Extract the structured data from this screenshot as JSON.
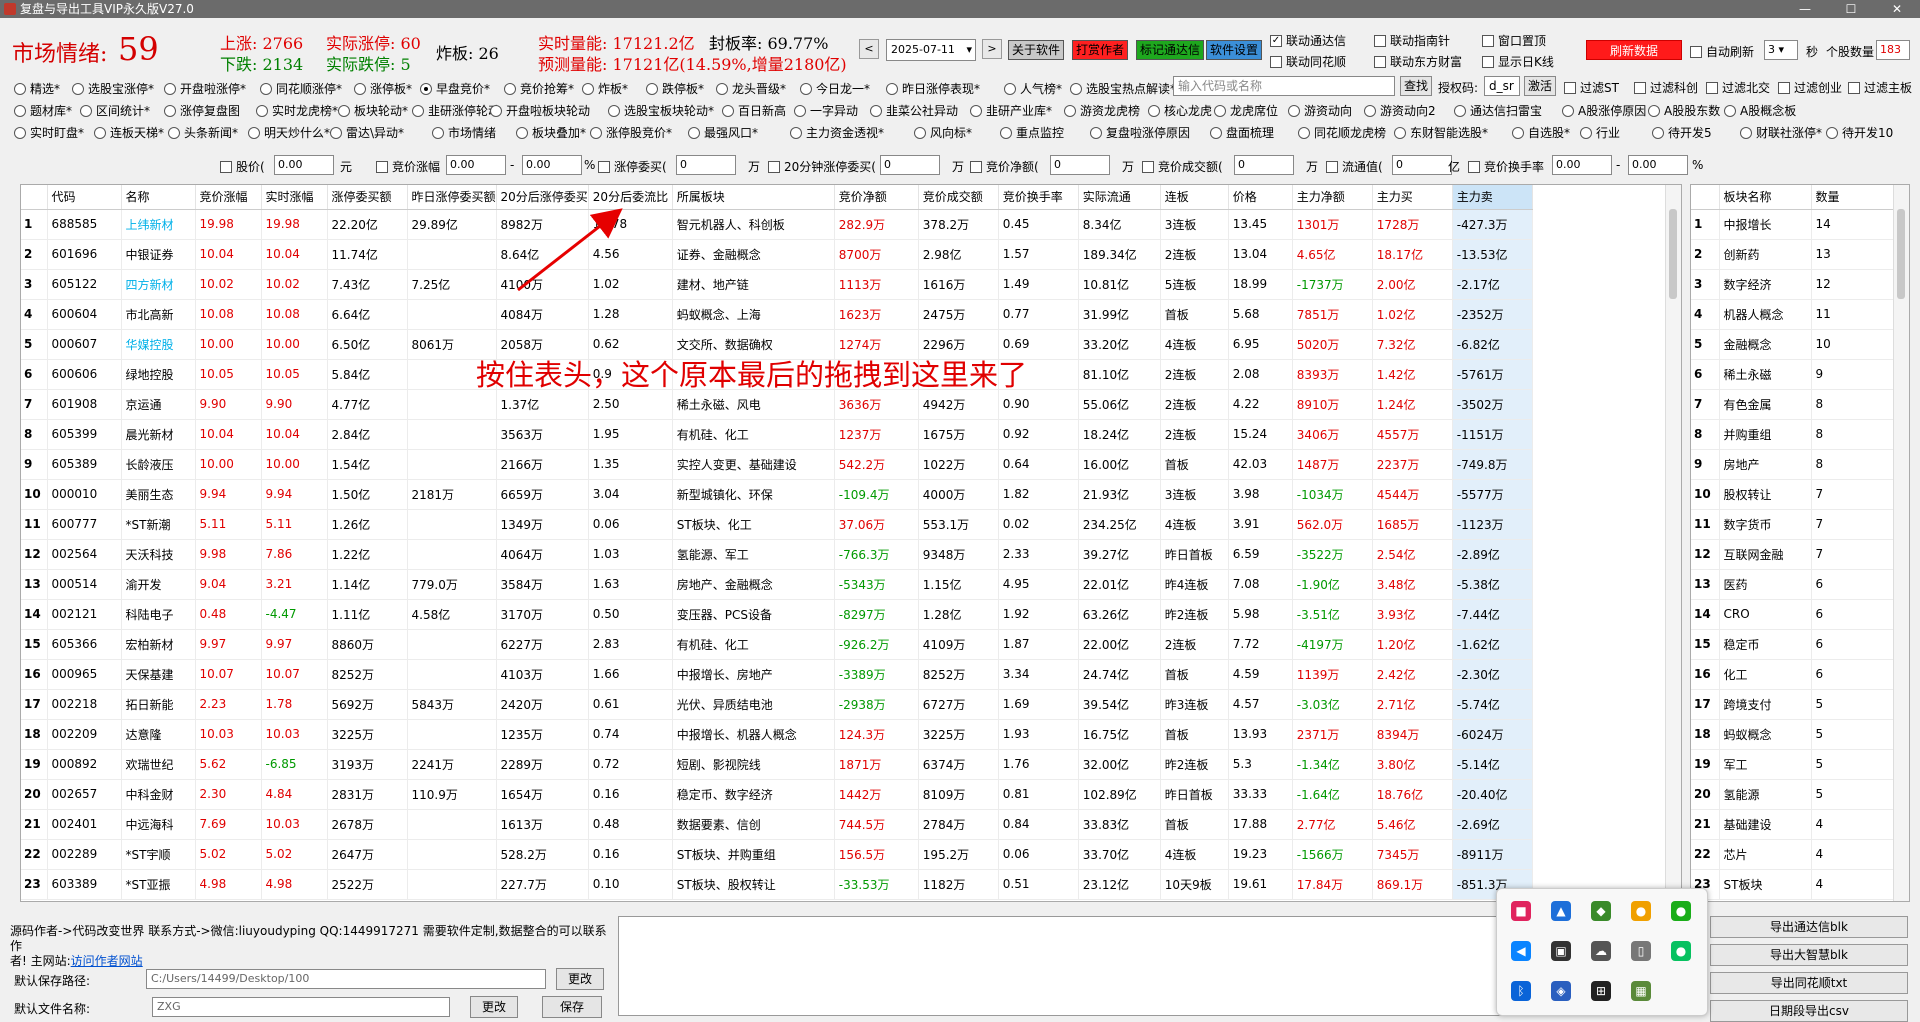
{
  "window": {
    "title": "复盘与导出工具VIP永久版V27.0"
  },
  "stats": {
    "sentiment_label": "市场情绪:",
    "sentiment_value": "59",
    "rise": "上涨: 2766",
    "real_limit_up": "实际涨停: 60",
    "fall": "下跌: 2134",
    "real_limit_down": "实际跌停: 5",
    "broken": "炸板: 26",
    "realtime_vol": "实时量能: 17121.2亿",
    "seal_rate": "封板率: 69.77%",
    "forecast_vol": "预测量能: 17121亿(14.59%,增量2180亿)"
  },
  "toolbar": {
    "date": "2025-07-11",
    "about": "关于软件",
    "reward": "打赏作者",
    "tdx": "标记通达信",
    "settings": "软件设置",
    "link_tdx": "联动通达信",
    "link_ths": "联动同花顺",
    "link_znz": "联动指南针",
    "link_dfcf": "联动东方财富",
    "win_top": "窗口置顶",
    "show_kline": "显示日K线",
    "refresh": "刷新数据",
    "auto_refresh": "自动刷新",
    "interval": "3",
    "sec": "秒",
    "stock_count_label": "个股数量",
    "stock_count": "183"
  },
  "tabs": {
    "row1": [
      "精选*",
      "选股宝涨停*",
      "开盘啦涨停*",
      "同花顺涨停*",
      "涨停板*",
      "早盘竞价*",
      "竞价抢筹*",
      "炸板*",
      "跌停板*",
      "龙头晋级*",
      "今日龙一*",
      "昨日涨停表现*",
      "人气榜*",
      "选股宝热点解读*"
    ],
    "row2": [
      "题材库*",
      "区间统计*",
      "涨停复盘图",
      "实时龙虎榜*",
      "板块轮动*",
      "韭研涨停轮动",
      "开盘啦板块轮动",
      "选股宝板块轮动*",
      "百日新高",
      "一字异动",
      "韭菜公社异动",
      "韭研产业库*",
      "游资龙虎榜",
      "核心龙虎",
      "龙虎席位",
      "游资动向",
      "游资动向2",
      "通达信扫雷宝",
      "A股涨停原因",
      "A股股东数",
      "A股概念板"
    ],
    "row3": [
      "实时盯盘*",
      "连板天梯*",
      "头条新闻*",
      "明天炒什么*",
      "雷达\\异动*",
      "市场情绪",
      "板块叠加*",
      "涨停股竞价*",
      "最强风口*",
      "主力资金透视*",
      "风向标*",
      "重点监控",
      "复盘啦涨停原因",
      "盘面梳理",
      "同花顺龙虎榜",
      "东财智能选股*",
      "自选股*",
      "行业",
      "待开发5",
      "财联社涨停*",
      "待开发10"
    ],
    "selected": "早盘竞价*",
    "search_placeholder": "输入代码或名称",
    "search_btn": "查找",
    "auth_label": "授权码:",
    "auth_value": "d_sr",
    "activate": "激活",
    "filters": [
      "过滤ST",
      "过滤科创",
      "过滤北交",
      "过滤创业",
      "过滤主板"
    ]
  },
  "filterbar": {
    "labels": [
      "股价(",
      "元",
      "竞价涨幅",
      "-",
      "%",
      "涨停委买(",
      "万",
      "20分钟涨停委买(",
      "万",
      "竞价净额(",
      "万",
      "竞价成交额(",
      "万",
      "流通值(",
      "亿",
      "竞价换手率",
      "-",
      "%"
    ],
    "zero": "0.00",
    "zero_int": "0"
  },
  "table": {
    "columns": [
      "",
      "代码",
      "名称",
      "竞价涨幅",
      "实时涨幅",
      "涨停委买额",
      "昨日涨停委买额",
      "20分后涨停委买",
      "20分后委流比",
      "所属板块",
      "竞价净额",
      "竞价成交额",
      "竞价换手率",
      "实际流通",
      "连板",
      "价格",
      "主力净额",
      "主力买",
      "主力卖"
    ],
    "rows": [
      [
        "1",
        "688585",
        "上纬新材",
        "19.98",
        "19.98",
        "22.20亿",
        "29.89亿",
        "8982万",
        "10.78",
        "智元机器人、科创板",
        "282.9万",
        "378.2万",
        "0.45",
        "8.34亿",
        "3连板",
        "13.45",
        "1301万",
        "1728万",
        "-427.3万"
      ],
      [
        "2",
        "601696",
        "中银证券",
        "10.04",
        "10.04",
        "11.74亿",
        "",
        "8.64亿",
        "4.56",
        "证券、金融概念",
        "8700万",
        "2.98亿",
        "1.57",
        "189.34亿",
        "2连板",
        "13.04",
        "4.65亿",
        "18.17亿",
        "-13.53亿"
      ],
      [
        "3",
        "605122",
        "四方新材",
        "10.02",
        "10.02",
        "7.43亿",
        "7.25亿",
        "4100万",
        "1.02",
        "建材、地产链",
        "1113万",
        "1616万",
        "1.49",
        "10.81亿",
        "5连板",
        "18.99",
        "-1737万",
        "2.00亿",
        "-2.17亿"
      ],
      [
        "4",
        "600604",
        "市北高新",
        "10.08",
        "10.08",
        "6.64亿",
        "",
        "4084万",
        "1.28",
        "蚂蚁概念、上海",
        "1623万",
        "2475万",
        "0.77",
        "31.99亿",
        "首板",
        "5.68",
        "7851万",
        "1.02亿",
        "-2352万"
      ],
      [
        "5",
        "000607",
        "华媒控股",
        "10.00",
        "10.00",
        "6.50亿",
        "8061万",
        "2058万",
        "0.62",
        "文交所、数据确权",
        "1274万",
        "2296万",
        "0.69",
        "33.20亿",
        "4连板",
        "6.95",
        "5020万",
        "7.32亿",
        "-6.82亿"
      ],
      [
        "6",
        "600606",
        "绿地控股",
        "10.05",
        "10.05",
        "5.84亿",
        "",
        "",
        "0.9",
        "",
        "",
        "",
        "",
        "81.10亿",
        "2连板",
        "2.08",
        "8393万",
        "1.42亿",
        "-5761万"
      ],
      [
        "7",
        "601908",
        "京运通",
        "9.90",
        "9.90",
        "4.77亿",
        "",
        "1.37亿",
        "2.50",
        "稀土永磁、风电",
        "3636万",
        "4942万",
        "0.90",
        "55.06亿",
        "2连板",
        "4.22",
        "8910万",
        "1.24亿",
        "-3502万"
      ],
      [
        "8",
        "605399",
        "晨光新材",
        "10.04",
        "10.04",
        "2.84亿",
        "",
        "3563万",
        "1.95",
        "有机硅、化工",
        "1237万",
        "1675万",
        "0.92",
        "18.24亿",
        "2连板",
        "15.24",
        "3406万",
        "4557万",
        "-1151万"
      ],
      [
        "9",
        "605389",
        "长龄液压",
        "10.00",
        "10.00",
        "1.54亿",
        "",
        "2166万",
        "1.35",
        "实控人变更、基础建设",
        "542.2万",
        "1022万",
        "0.64",
        "16.00亿",
        "首板",
        "42.03",
        "1487万",
        "2237万",
        "-749.8万"
      ],
      [
        "10",
        "000010",
        "美丽生态",
        "9.94",
        "9.94",
        "1.50亿",
        "2181万",
        "6659万",
        "3.04",
        "新型城镇化、环保",
        "-109.4万",
        "4000万",
        "1.82",
        "21.93亿",
        "3连板",
        "3.98",
        "-1034万",
        "4544万",
        "-5577万"
      ],
      [
        "11",
        "600777",
        "*ST新潮",
        "5.11",
        "5.11",
        "1.26亿",
        "",
        "1349万",
        "0.06",
        "ST板块、化工",
        "37.06万",
        "553.1万",
        "0.02",
        "234.25亿",
        "4连板",
        "3.91",
        "562.0万",
        "1685万",
        "-1123万"
      ],
      [
        "12",
        "002564",
        "天沃科技",
        "9.98",
        "7.86",
        "1.22亿",
        "",
        "4064万",
        "1.03",
        "氢能源、军工",
        "-766.3万",
        "9348万",
        "2.33",
        "39.27亿",
        "昨日首板",
        "6.59",
        "-3522万",
        "2.54亿",
        "-2.89亿"
      ],
      [
        "13",
        "000514",
        "渝开发",
        "9.04",
        "3.21",
        "1.14亿",
        "779.0万",
        "3584万",
        "1.63",
        "房地产、金融概念",
        "-5343万",
        "1.15亿",
        "4.95",
        "22.01亿",
        "昨4连板",
        "7.08",
        "-1.90亿",
        "3.48亿",
        "-5.38亿"
      ],
      [
        "14",
        "002121",
        "科陆电子",
        "0.48",
        "-4.47",
        "1.11亿",
        "4.58亿",
        "3170万",
        "0.50",
        "变压器、PCS设备",
        "-8297万",
        "1.28亿",
        "1.92",
        "63.26亿",
        "昨2连板",
        "5.98",
        "-3.51亿",
        "3.93亿",
        "-7.44亿"
      ],
      [
        "15",
        "605366",
        "宏柏新材",
        "9.97",
        "9.97",
        "8860万",
        "",
        "6227万",
        "2.83",
        "有机硅、化工",
        "-926.2万",
        "4109万",
        "1.87",
        "22.00亿",
        "2连板",
        "7.72",
        "-4197万",
        "1.20亿",
        "-1.62亿"
      ],
      [
        "16",
        "000965",
        "天保基建",
        "10.07",
        "10.07",
        "8252万",
        "",
        "4103万",
        "1.66",
        "中报增长、房地产",
        "-3389万",
        "8252万",
        "3.34",
        "24.74亿",
        "首板",
        "4.59",
        "1139万",
        "2.42亿",
        "-2.30亿"
      ],
      [
        "17",
        "002218",
        "拓日新能",
        "2.23",
        "1.78",
        "5692万",
        "5843万",
        "2420万",
        "0.61",
        "光伏、异质结电池",
        "-2938万",
        "6727万",
        "1.69",
        "39.54亿",
        "昨3连板",
        "4.57",
        "-3.03亿",
        "2.71亿",
        "-5.74亿"
      ],
      [
        "18",
        "002209",
        "达意隆",
        "10.03",
        "10.03",
        "3225万",
        "",
        "1235万",
        "0.74",
        "中报增长、机器人概念",
        "124.3万",
        "3225万",
        "1.93",
        "16.75亿",
        "首板",
        "13.93",
        "2371万",
        "8394万",
        "-6024万"
      ],
      [
        "19",
        "000892",
        "欢瑞世纪",
        "5.62",
        "-6.85",
        "3193万",
        "2241万",
        "2289万",
        "0.72",
        "短剧、影视院线",
        "1871万",
        "6374万",
        "1.76",
        "32.00亿",
        "昨2连板",
        "5.3",
        "-1.34亿",
        "3.80亿",
        "-5.14亿"
      ],
      [
        "20",
        "002657",
        "中科金财",
        "2.30",
        "4.84",
        "2831万",
        "110.9万",
        "1654万",
        "0.16",
        "稳定币、数字经济",
        "1442万",
        "8109万",
        "0.81",
        "102.89亿",
        "昨日首板",
        "33.33",
        "-1.64亿",
        "18.76亿",
        "-20.40亿"
      ],
      [
        "21",
        "002401",
        "中远海科",
        "7.69",
        "10.03",
        "2678万",
        "",
        "1613万",
        "0.48",
        "数据要素、信创",
        "744.5万",
        "2784万",
        "0.84",
        "33.83亿",
        "首板",
        "17.88",
        "2.77亿",
        "5.46亿",
        "-2.69亿"
      ],
      [
        "22",
        "002289",
        "*ST宇顺",
        "5.02",
        "5.02",
        "2647万",
        "",
        "528.2万",
        "0.16",
        "ST板块、并购重组",
        "156.5万",
        "195.2万",
        "0.06",
        "33.70亿",
        "4连板",
        "19.23",
        "-1566万",
        "7345万",
        "-8911万"
      ],
      [
        "23",
        "603389",
        "*ST亚振",
        "4.98",
        "4.98",
        "2522万",
        "",
        "227.7万",
        "0.10",
        "ST板块、股权转让",
        "-33.53万",
        "1182万",
        "0.51",
        "23.12亿",
        "10天9板",
        "19.61",
        "17.84万",
        "869.1万",
        "-851.3万"
      ]
    ],
    "cyan_names": [
      "上纬新材",
      "四方新材",
      "华媒控股"
    ],
    "annotation": "按住表头，这个原本最后的拖拽到这里来了"
  },
  "sector_table": {
    "columns": [
      "",
      "板块名称",
      "数量"
    ],
    "rows": [
      [
        "1",
        "中报增长",
        "14"
      ],
      [
        "2",
        "创新药",
        "13"
      ],
      [
        "3",
        "数字经济",
        "12"
      ],
      [
        "4",
        "机器人概念",
        "11"
      ],
      [
        "5",
        "金融概念",
        "10"
      ],
      [
        "6",
        "稀土永磁",
        "9"
      ],
      [
        "7",
        "有色金属",
        "8"
      ],
      [
        "8",
        "并购重组",
        "8"
      ],
      [
        "9",
        "房地产",
        "8"
      ],
      [
        "10",
        "股权转让",
        "7"
      ],
      [
        "11",
        "数字货币",
        "7"
      ],
      [
        "12",
        "互联网金融",
        "7"
      ],
      [
        "13",
        "医药",
        "6"
      ],
      [
        "14",
        "CRO",
        "6"
      ],
      [
        "15",
        "稳定币",
        "6"
      ],
      [
        "16",
        "化工",
        "6"
      ],
      [
        "17",
        "跨境支付",
        "5"
      ],
      [
        "18",
        "蚂蚁概念",
        "5"
      ],
      [
        "19",
        "军工",
        "5"
      ],
      [
        "20",
        "氢能源",
        "5"
      ],
      [
        "21",
        "基础建设",
        "4"
      ],
      [
        "22",
        "芯片",
        "4"
      ],
      [
        "23",
        "ST板块",
        "4"
      ]
    ]
  },
  "bottom": {
    "info_line1": "源码作者->代码改变世界 联系方式->微信:liuyoudyping QQ:1449917271 需要软件定制,数据整合的可以联系作",
    "info_line2": "者! 主网站:",
    "site_link": "访问作者网站",
    "save_path_label": "默认保存路径:",
    "save_path": "C:/Users/14499/Desktop/100",
    "change": "更改",
    "file_name_label": "默认文件名称:",
    "file_name": "ZXG",
    "change2": "更改",
    "save": "保存",
    "export_tdx": "导出通达信blk",
    "export_dzh": "导出大智慧blk",
    "export_ths": "导出同花顺txt",
    "export_csv": "日期段导出csv"
  }
}
